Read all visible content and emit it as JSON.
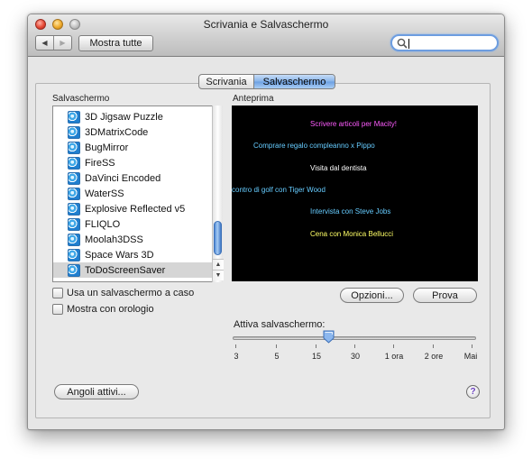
{
  "window": {
    "title": "Scrivania e Salvaschermo"
  },
  "toolbar": {
    "back_icon": "chevron-left-icon",
    "forward_icon": "chevron-right-icon",
    "back_glyph": "◀",
    "forward_glyph": "▶",
    "show_all_label": "Mostra tutte",
    "search": {
      "value": "",
      "placeholder": "",
      "icon": "search-icon"
    }
  },
  "tabs": [
    {
      "label": "Scrivania",
      "selected": false
    },
    {
      "label": "Salvaschermo",
      "selected": true
    }
  ],
  "screensaver_list": {
    "header": "Salvaschermo",
    "items": [
      {
        "label": "3D Jigsaw Puzzle"
      },
      {
        "label": "3DMatrixCode"
      },
      {
        "label": "BugMirror"
      },
      {
        "label": "FireSS"
      },
      {
        "label": "DaVinci Encoded"
      },
      {
        "label": "WaterSS"
      },
      {
        "label": "Explosive Reflected v5"
      },
      {
        "label": "FLIQLO"
      },
      {
        "label": "Moolah3DSS"
      },
      {
        "label": "Space Wars 3D"
      },
      {
        "label": "ToDoScreenSaver",
        "selected": true
      }
    ],
    "scroll_up_glyph": "▲",
    "scroll_down_glyph": "▼"
  },
  "options": {
    "random_label": "Usa un salvaschermo a caso",
    "random_checked": false,
    "clock_label": "Mostra con orologio",
    "clock_checked": false
  },
  "preview": {
    "header": "Anteprima",
    "items": [
      {
        "text": "Scrivere articoli per Macity!",
        "color": "#ff5cff"
      },
      {
        "text": "Comprare regalo compleanno x Pippo",
        "color": "#66ccff"
      },
      {
        "text": "Visita dal dentista",
        "color": "#ffffff"
      },
      {
        "text": "contro di golf con Tiger Wood",
        "color": "#66ccff"
      },
      {
        "text": "Intervista con Steve Jobs",
        "color": "#66ccff"
      },
      {
        "text": "Cena con Monica Bellucci",
        "color": "#ffff66"
      }
    ]
  },
  "buttons": {
    "options_label": "Opzioni...",
    "test_label": "Prova",
    "hot_corners_label": "Angoli attivi...",
    "help_label": "?"
  },
  "slider": {
    "label": "Attiva salvaschermo:",
    "ticks": [
      "3",
      "5",
      "15",
      "30",
      "1 ora",
      "2 ore",
      "Mai"
    ],
    "value_position": 0.39
  },
  "colors": {
    "accent": "#6b9fe2",
    "selection": "#d5d5d5",
    "help_icon": "#6a3fbf"
  }
}
